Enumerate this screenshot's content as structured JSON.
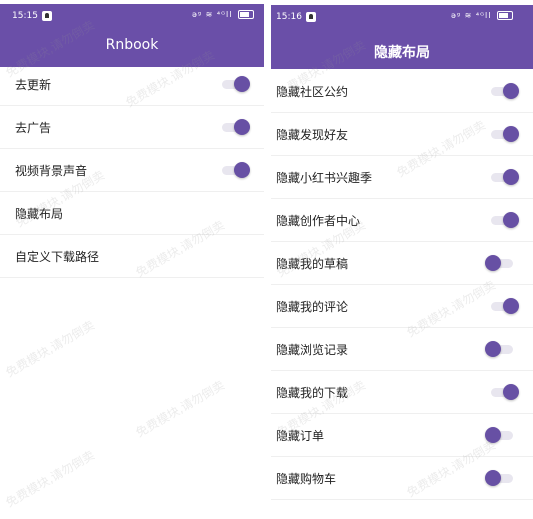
{
  "colors": {
    "accent": "#6a4fa8",
    "thumb": "#6750a4",
    "track": "#e8e6ef"
  },
  "left": {
    "status": {
      "time": "15:15",
      "indicators": "ǝᵍ ≋ ⁴ᴳll"
    },
    "title": "Rnbook",
    "items": [
      {
        "label": "去更新",
        "toggle": "on"
      },
      {
        "label": "去广告",
        "toggle": "on"
      },
      {
        "label": "视频背景声音",
        "toggle": "on"
      },
      {
        "label": "隐藏布局",
        "toggle": "none"
      },
      {
        "label": "自定义下载路径",
        "toggle": "none"
      }
    ]
  },
  "right": {
    "status": {
      "time": "15:16",
      "indicators": "ǝᵍ ≋ ⁴ᴳll"
    },
    "title": "隐藏布局",
    "items": [
      {
        "label": "隐藏社区公约",
        "toggle": "on"
      },
      {
        "label": "隐藏发现好友",
        "toggle": "on"
      },
      {
        "label": "隐藏小红书兴趣季",
        "toggle": "on"
      },
      {
        "label": "隐藏创作者中心",
        "toggle": "on"
      },
      {
        "label": "隐藏我的草稿",
        "toggle": "off"
      },
      {
        "label": "隐藏我的评论",
        "toggle": "on"
      },
      {
        "label": "隐藏浏览记录",
        "toggle": "off"
      },
      {
        "label": "隐藏我的下载",
        "toggle": "on"
      },
      {
        "label": "隐藏订单",
        "toggle": "off"
      },
      {
        "label": "隐藏购物车",
        "toggle": "off"
      }
    ]
  },
  "watermark": "免费模块,请勿倒卖"
}
